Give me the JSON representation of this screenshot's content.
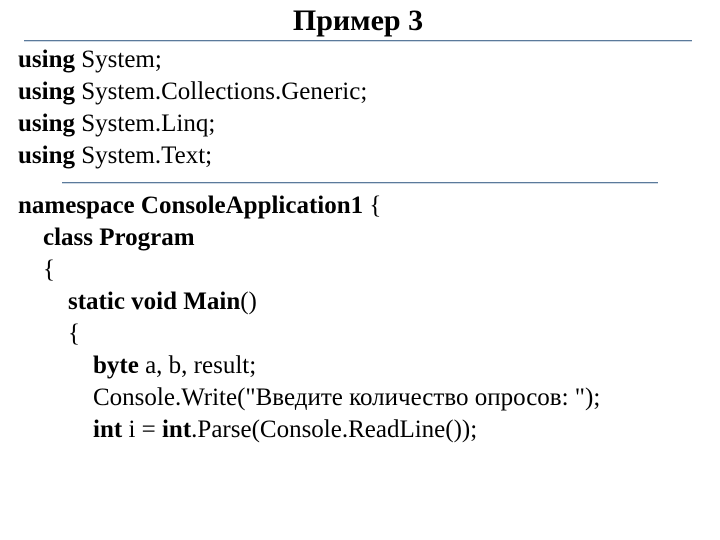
{
  "title": "Пример 3",
  "code": {
    "l1_kw": "using",
    "l1_rest": " System;",
    "l2_kw": "using",
    "l2_rest": " System.Collections.Generic;",
    "l3_kw": "using",
    "l3_rest": " System.Linq;",
    "l4_kw": "using",
    "l4_rest": " System.Text;",
    "l5_kw": "namespace ConsoleApplication1",
    "l5_rest": " {",
    "l6_kw": "class Program",
    "l7": "    {",
    "l8_kw": "static void Main",
    "l8_rest": "()",
    "l9": "        {",
    "l10_kw": "byte",
    "l10_rest": " a, b, result;",
    "l11": "            Console.Write(\"Введите количество опросов: \");",
    "l12_kw1": "int",
    "l12_mid": " i = ",
    "l12_kw2": "int",
    "l12_rest": ".Parse(Console.ReadLine());"
  }
}
